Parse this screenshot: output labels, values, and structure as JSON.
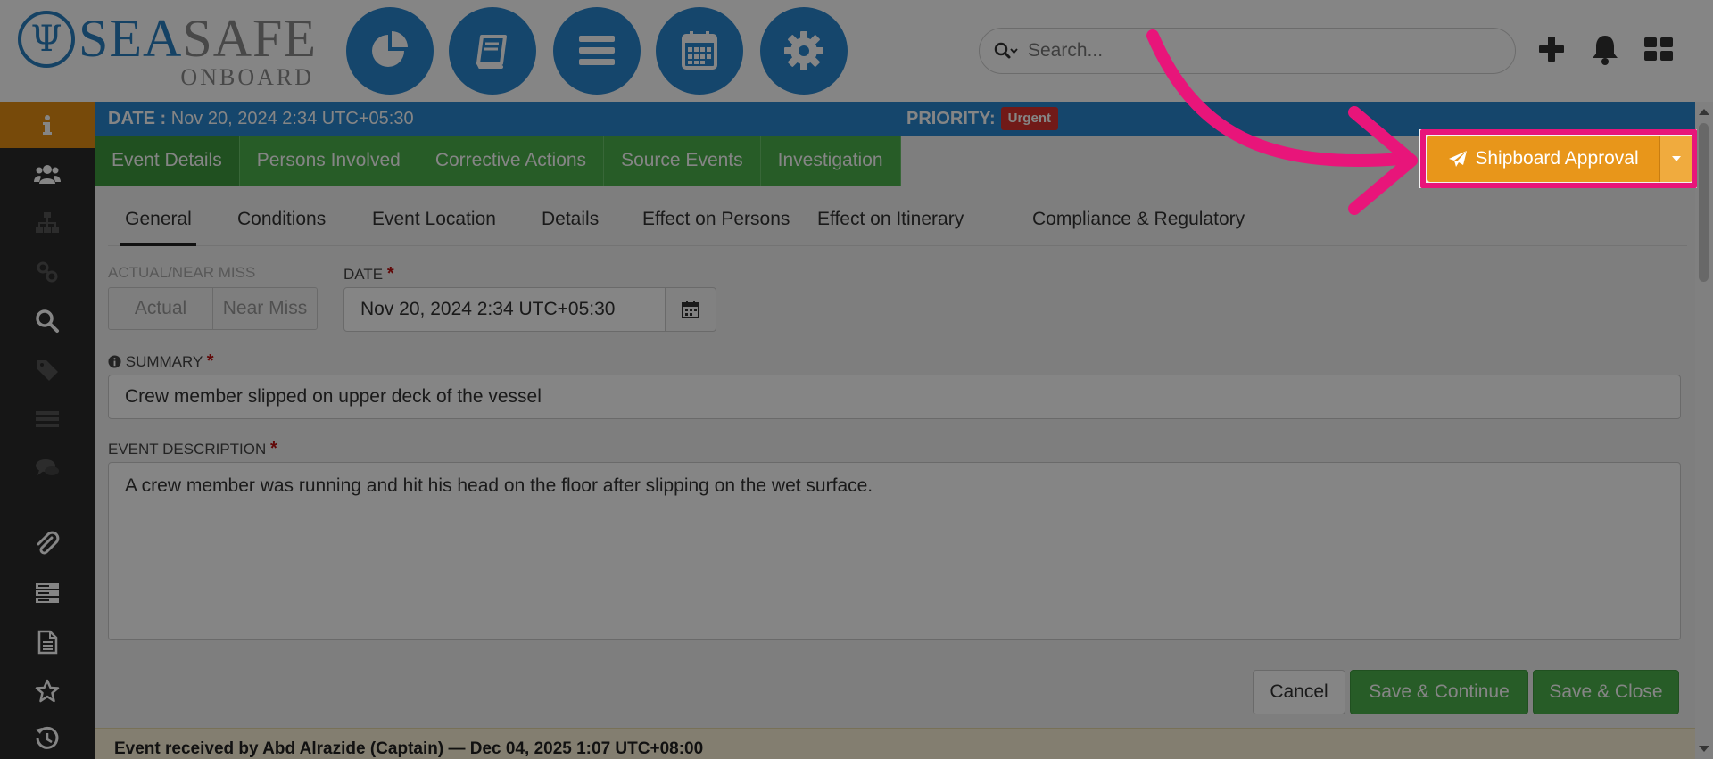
{
  "brand": {
    "logo_sea": "SEA",
    "logo_safe": "SAFE",
    "logo_sub": "ONBOARD",
    "accent": "#2a86cf",
    "green": "#4cb04c",
    "orange": "#e8961a",
    "highlight": "#e8157a"
  },
  "header": {
    "nav_icons": [
      "dashboard-pie-icon",
      "book-icon",
      "menu-icon",
      "calendar-icon",
      "settings-gear-icon"
    ],
    "search_placeholder": "Search...",
    "right_icons": [
      "plus-icon",
      "bell-icon",
      "grid-icon"
    ]
  },
  "sidebar": {
    "items": [
      "info-icon",
      "users-icon",
      "org-chart-icon",
      "link-icon",
      "search-icon",
      "tag-icon",
      "list-icon",
      "chat-icon",
      "paperclip-icon",
      "server-icon",
      "document-icon",
      "star-icon",
      "history-icon"
    ]
  },
  "infobar": {
    "date_label": "DATE :",
    "date_value": " Nov 20, 2024 2:34 UTC+05:30",
    "priority_label": "PRIORITY:",
    "priority_value": "Urgent"
  },
  "main_tabs": [
    "Event Details",
    "Persons Involved",
    "Corrective Actions",
    "Source Events",
    "Investigation"
  ],
  "sub_tabs": [
    "General",
    "Conditions",
    "Event Location",
    "Details",
    "Effect on Persons",
    "Effect on Itinerary",
    "Compliance & Regulatory"
  ],
  "form": {
    "actual_near_miss_label": "ACTUAL/NEAR MISS",
    "actual_option": "Actual",
    "near_miss_option": "Near Miss",
    "date_label": "DATE",
    "date_value": "Nov 20, 2024 2:34 UTC+05:30",
    "summary_label": "SUMMARY",
    "summary_value": "Crew member slipped on upper deck of the vessel",
    "description_label": "EVENT DESCRIPTION",
    "description_value": "A crew member was running and hit his head on the floor after slipping on the wet surface.",
    "required_mark": "*"
  },
  "buttons": {
    "cancel": "Cancel",
    "save_continue": "Save & Continue",
    "save_close": "Save & Close",
    "shipboard_approval": "Shipboard Approval"
  },
  "footer": {
    "text": "Event received by Abd Alrazide (Captain) — Dec 04, 2025 1:07 UTC+08:00"
  }
}
